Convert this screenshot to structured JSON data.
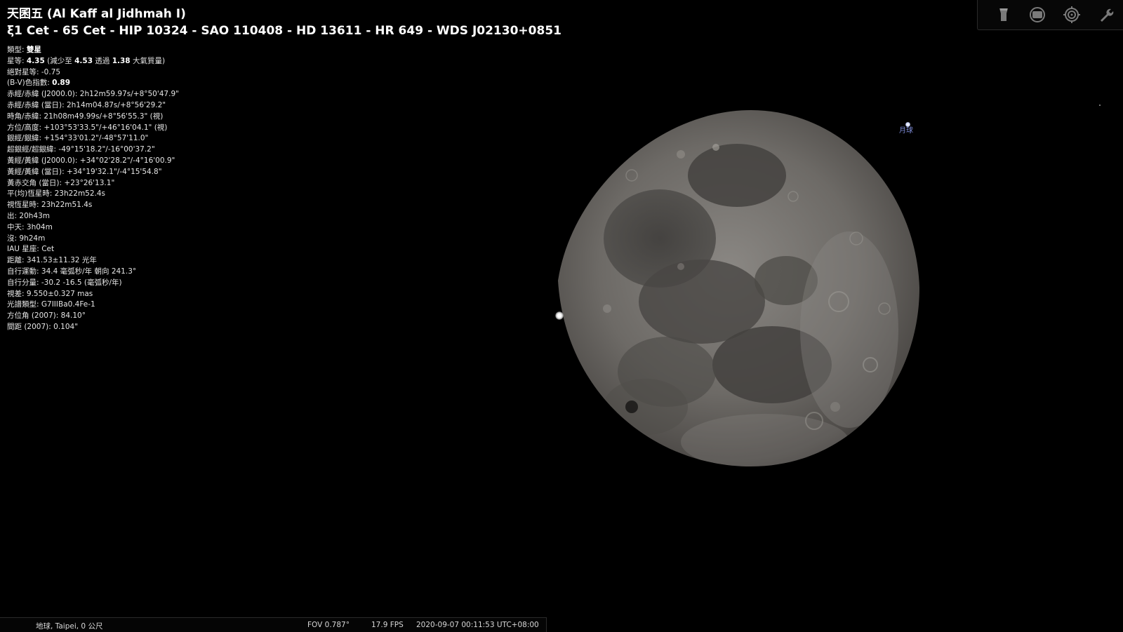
{
  "object": {
    "title": "天囷五 (Al Kaff al Jidhmah I)",
    "designations": "ξ1 Cet - 65 Cet - HIP 10324 - SAO 110408 - HD 13611 - HR 649 - WDS J02130+0851",
    "rows": [
      {
        "label": "類型: ",
        "value": "雙星",
        "bold": true
      },
      {
        "label": "星等: ",
        "value": "4.35",
        "bold": true,
        "extra": " (減少至 ",
        "extra_bold": "4.53",
        "extra2": " 透過 ",
        "extra2_bold": "1.38",
        "extra3": " 大氣質量)"
      },
      {
        "label": "絕對星等: ",
        "value": "-0.75"
      },
      {
        "label": "(B-V)色指數: ",
        "value": "0.89",
        "bold": true
      },
      {
        "label": "赤經/赤緯 (J2000.0): ",
        "value": "2h12m59.97s/+8°50'47.9\""
      },
      {
        "label": "赤經/赤緯 (當日): ",
        "value": "2h14m04.87s/+8°56'29.2\""
      },
      {
        "label": "時角/赤緯: ",
        "value": "21h08m49.99s/+8°56'55.3\" (視)"
      },
      {
        "label": "方位/高度: ",
        "value": "+103°53'33.5\"/+46°16'04.1\" (視)"
      },
      {
        "label": "銀經/銀緯: ",
        "value": "+154°33'01.2\"/-48°57'11.0\""
      },
      {
        "label": "超銀經/超銀緯: ",
        "value": "-49°15'18.2\"/-16°00'37.2\""
      },
      {
        "label": "黃經/黃緯 (J2000.0): ",
        "value": "+34°02'28.2\"/-4°16'00.9\""
      },
      {
        "label": "黃經/黃緯 (當日): ",
        "value": "+34°19'32.1\"/-4°15'54.8\""
      },
      {
        "label": "黃赤交角 (當日): ",
        "value": "+23°26'13.1\""
      },
      {
        "label": "平(均)恆星時: ",
        "value": "23h22m52.4s"
      },
      {
        "label": "視恆星時: ",
        "value": "23h22m51.4s"
      },
      {
        "label": "出: ",
        "value": "20h43m"
      },
      {
        "label": "中天: ",
        "value": "3h04m"
      },
      {
        "label": "沒: ",
        "value": "9h24m"
      },
      {
        "label": "IAU 星座: ",
        "value": "Cet"
      },
      {
        "label": "距離: ",
        "value": "341.53±11.32 光年"
      },
      {
        "label": "自行運動: ",
        "value": "34.4 毫弧秒/年 朝向 241.3°"
      },
      {
        "label": "自行分量: ",
        "value": "-30.2 -16.5 (毫弧秒/年)"
      },
      {
        "label": "視差: ",
        "value": "9.550±0.327 mas"
      },
      {
        "label": "光譜類型: ",
        "value": "G7IIIBa0.4Fe-1"
      },
      {
        "label": "方位角 (2007): ",
        "value": "84.10°"
      },
      {
        "label": "間距 (2007): ",
        "value": "0.104\""
      }
    ]
  },
  "sky": {
    "moon_label": "月球"
  },
  "toolbar": {
    "buttons": [
      {
        "icon": "flashlight-icon"
      },
      {
        "icon": "screen-icon"
      },
      {
        "icon": "target-icon"
      },
      {
        "icon": "wrench-icon"
      }
    ]
  },
  "status": {
    "location": "地球, Taipei, 0 公尺",
    "fov": "FOV 0.787°",
    "fps": "17.9 FPS",
    "datetime": "2020-09-07 00:11:53 UTC+08:00"
  },
  "colors": {
    "background": "#000000",
    "moon_label": "#7d8bd6",
    "text": "#e6e6e6"
  }
}
